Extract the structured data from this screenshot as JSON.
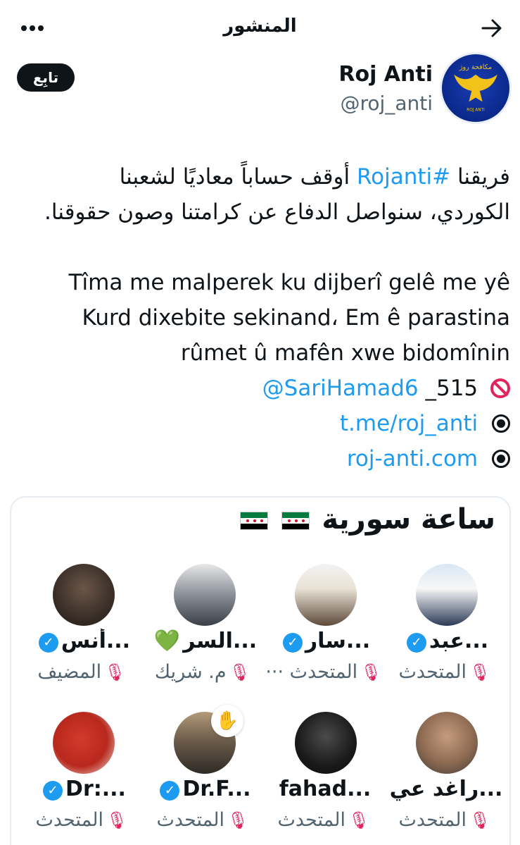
{
  "header": {
    "title": "المنشور"
  },
  "author": {
    "display_name": "Roj Anti",
    "handle": "@roj_anti",
    "follow_label": "تابِع",
    "avatar_label": "مكافحة روژ"
  },
  "post": {
    "ar_line1_prefix": "فريقنا ",
    "ar_line1_hashtag": "#Rojanti",
    "ar_line1_suffix": " أوقف حساباً معاديًا لشعبنا",
    "ar_line2": "الكوردي، سنواصل الدفاع عن كرامتنا وصون حقوقنا.",
    "ku_line1": "Tîma me malperek ku dijberî gelê me yê",
    "ku_line2": "Kurd dixebite sekinand، Em ê parastina",
    "ku_line3": "rûmet û mafên xwe bidomînin",
    "mention": "@SariHamad6",
    "mention_suffix": "_515",
    "link1": "t.me/roj_anti",
    "link2": "roj-anti.com"
  },
  "card": {
    "title": "ساعة سورية",
    "speakers": [
      {
        "name": "عبد...",
        "role": "المتحدث",
        "verified": true
      },
      {
        "name": "سار...",
        "role": "المتحدث",
        "verified": true
      },
      {
        "name": "السر...",
        "role": "م. شريك",
        "verified": false
      },
      {
        "name": "أنس...",
        "role": "المضيف",
        "verified": true
      },
      {
        "name": "راغد عي...",
        "role": "المتحدث",
        "verified": false
      },
      {
        "name": "fahad...",
        "role": "المتحدث",
        "verified": false
      },
      {
        "name": "Dr.F...",
        "role": "المتحدث",
        "verified": true
      },
      {
        "name": "Dr:...",
        "role": "المتحدث",
        "verified": true
      }
    ]
  }
}
